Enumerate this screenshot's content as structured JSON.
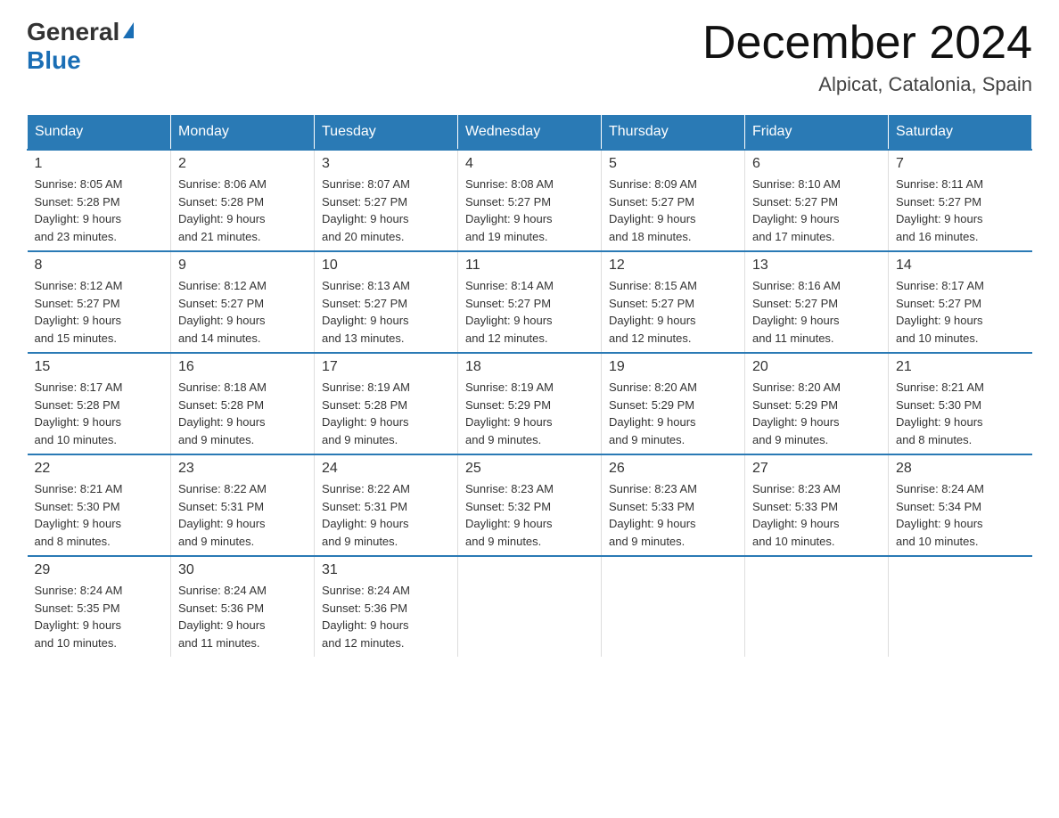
{
  "header": {
    "logo_general": "General",
    "logo_blue": "Blue",
    "month_title": "December 2024",
    "location": "Alpicat, Catalonia, Spain"
  },
  "days_of_week": [
    "Sunday",
    "Monday",
    "Tuesday",
    "Wednesday",
    "Thursday",
    "Friday",
    "Saturday"
  ],
  "weeks": [
    [
      {
        "num": "1",
        "sunrise": "8:05 AM",
        "sunset": "5:28 PM",
        "daylight": "9 hours and 23 minutes."
      },
      {
        "num": "2",
        "sunrise": "8:06 AM",
        "sunset": "5:28 PM",
        "daylight": "9 hours and 21 minutes."
      },
      {
        "num": "3",
        "sunrise": "8:07 AM",
        "sunset": "5:27 PM",
        "daylight": "9 hours and 20 minutes."
      },
      {
        "num": "4",
        "sunrise": "8:08 AM",
        "sunset": "5:27 PM",
        "daylight": "9 hours and 19 minutes."
      },
      {
        "num": "5",
        "sunrise": "8:09 AM",
        "sunset": "5:27 PM",
        "daylight": "9 hours and 18 minutes."
      },
      {
        "num": "6",
        "sunrise": "8:10 AM",
        "sunset": "5:27 PM",
        "daylight": "9 hours and 17 minutes."
      },
      {
        "num": "7",
        "sunrise": "8:11 AM",
        "sunset": "5:27 PM",
        "daylight": "9 hours and 16 minutes."
      }
    ],
    [
      {
        "num": "8",
        "sunrise": "8:12 AM",
        "sunset": "5:27 PM",
        "daylight": "9 hours and 15 minutes."
      },
      {
        "num": "9",
        "sunrise": "8:12 AM",
        "sunset": "5:27 PM",
        "daylight": "9 hours and 14 minutes."
      },
      {
        "num": "10",
        "sunrise": "8:13 AM",
        "sunset": "5:27 PM",
        "daylight": "9 hours and 13 minutes."
      },
      {
        "num": "11",
        "sunrise": "8:14 AM",
        "sunset": "5:27 PM",
        "daylight": "9 hours and 12 minutes."
      },
      {
        "num": "12",
        "sunrise": "8:15 AM",
        "sunset": "5:27 PM",
        "daylight": "9 hours and 12 minutes."
      },
      {
        "num": "13",
        "sunrise": "8:16 AM",
        "sunset": "5:27 PM",
        "daylight": "9 hours and 11 minutes."
      },
      {
        "num": "14",
        "sunrise": "8:17 AM",
        "sunset": "5:27 PM",
        "daylight": "9 hours and 10 minutes."
      }
    ],
    [
      {
        "num": "15",
        "sunrise": "8:17 AM",
        "sunset": "5:28 PM",
        "daylight": "9 hours and 10 minutes."
      },
      {
        "num": "16",
        "sunrise": "8:18 AM",
        "sunset": "5:28 PM",
        "daylight": "9 hours and 9 minutes."
      },
      {
        "num": "17",
        "sunrise": "8:19 AM",
        "sunset": "5:28 PM",
        "daylight": "9 hours and 9 minutes."
      },
      {
        "num": "18",
        "sunrise": "8:19 AM",
        "sunset": "5:29 PM",
        "daylight": "9 hours and 9 minutes."
      },
      {
        "num": "19",
        "sunrise": "8:20 AM",
        "sunset": "5:29 PM",
        "daylight": "9 hours and 9 minutes."
      },
      {
        "num": "20",
        "sunrise": "8:20 AM",
        "sunset": "5:29 PM",
        "daylight": "9 hours and 9 minutes."
      },
      {
        "num": "21",
        "sunrise": "8:21 AM",
        "sunset": "5:30 PM",
        "daylight": "9 hours and 8 minutes."
      }
    ],
    [
      {
        "num": "22",
        "sunrise": "8:21 AM",
        "sunset": "5:30 PM",
        "daylight": "9 hours and 8 minutes."
      },
      {
        "num": "23",
        "sunrise": "8:22 AM",
        "sunset": "5:31 PM",
        "daylight": "9 hours and 9 minutes."
      },
      {
        "num": "24",
        "sunrise": "8:22 AM",
        "sunset": "5:31 PM",
        "daylight": "9 hours and 9 minutes."
      },
      {
        "num": "25",
        "sunrise": "8:23 AM",
        "sunset": "5:32 PM",
        "daylight": "9 hours and 9 minutes."
      },
      {
        "num": "26",
        "sunrise": "8:23 AM",
        "sunset": "5:33 PM",
        "daylight": "9 hours and 9 minutes."
      },
      {
        "num": "27",
        "sunrise": "8:23 AM",
        "sunset": "5:33 PM",
        "daylight": "9 hours and 10 minutes."
      },
      {
        "num": "28",
        "sunrise": "8:24 AM",
        "sunset": "5:34 PM",
        "daylight": "9 hours and 10 minutes."
      }
    ],
    [
      {
        "num": "29",
        "sunrise": "8:24 AM",
        "sunset": "5:35 PM",
        "daylight": "9 hours and 10 minutes."
      },
      {
        "num": "30",
        "sunrise": "8:24 AM",
        "sunset": "5:36 PM",
        "daylight": "9 hours and 11 minutes."
      },
      {
        "num": "31",
        "sunrise": "8:24 AM",
        "sunset": "5:36 PM",
        "daylight": "9 hours and 12 minutes."
      },
      null,
      null,
      null,
      null
    ]
  ],
  "labels": {
    "sunrise": "Sunrise:",
    "sunset": "Sunset:",
    "daylight": "Daylight:"
  }
}
